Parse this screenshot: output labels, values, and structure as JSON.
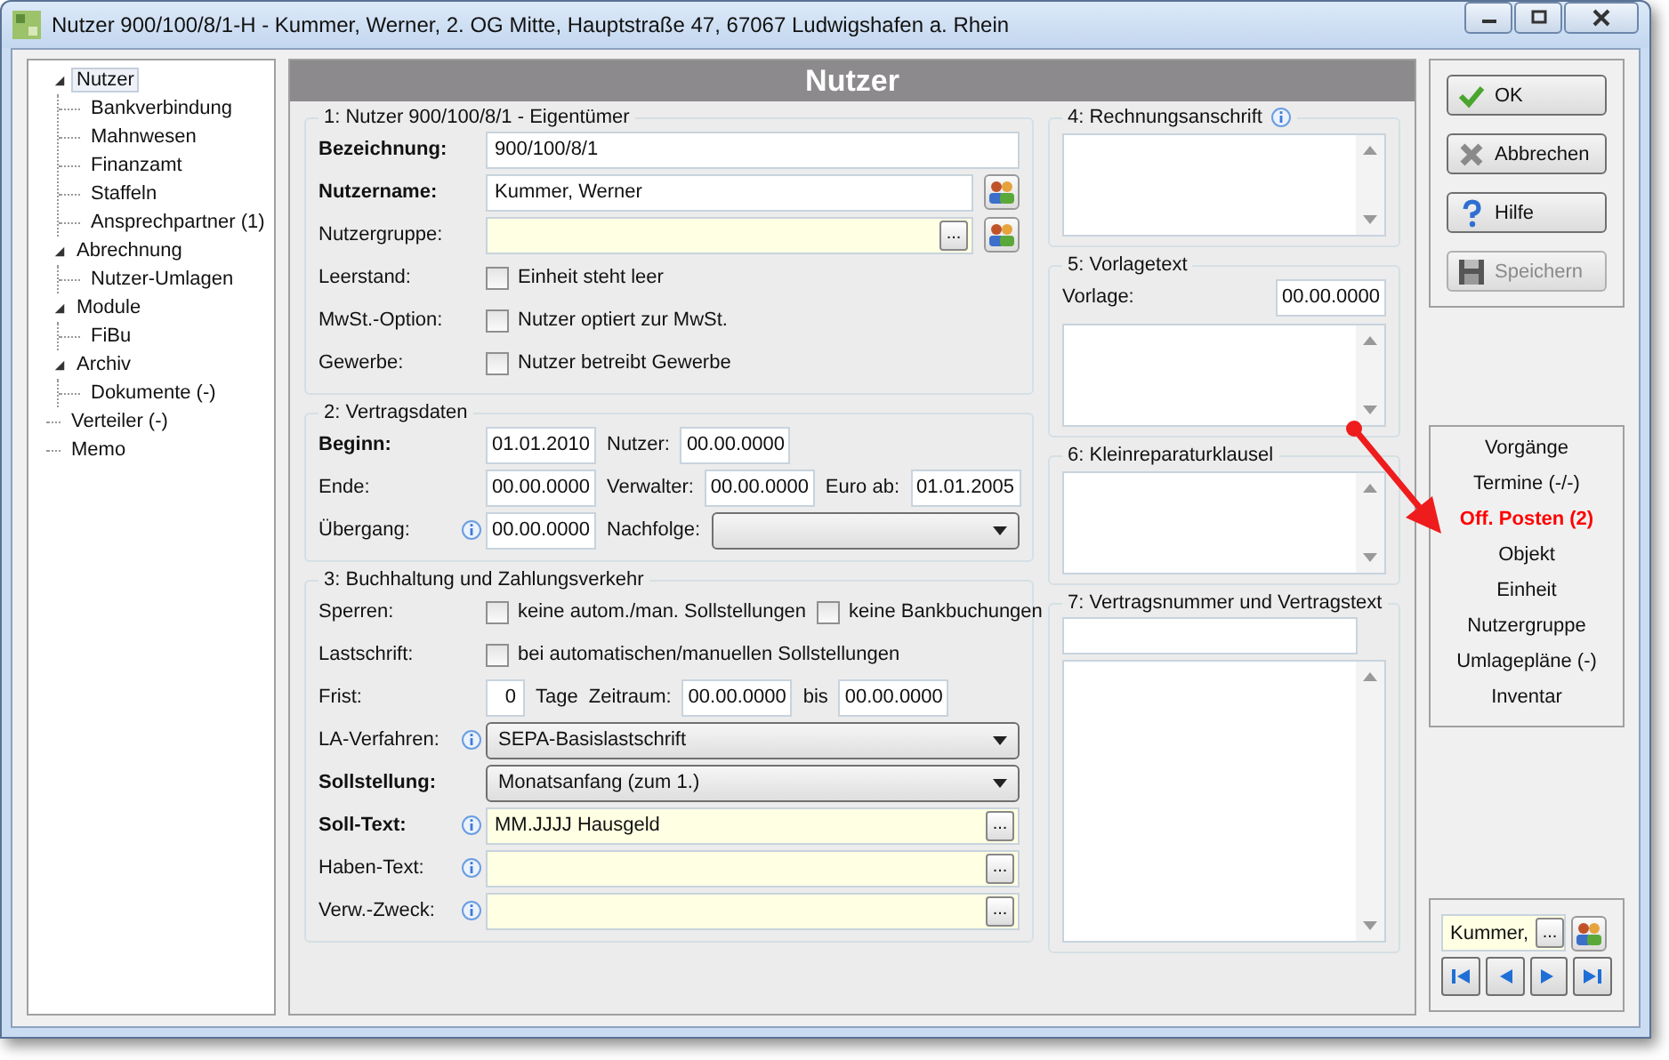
{
  "window": {
    "title": "Nutzer 900/100/8/1-H - Kummer, Werner, 2. OG Mitte, Hauptstraße 47, 67067 Ludwigshafen a. Rhein",
    "controls": [
      {
        "kind": "minimize"
      },
      {
        "kind": "maximize"
      },
      {
        "kind": "close"
      }
    ]
  },
  "tree": [
    {
      "label": "Nutzer",
      "selected": true,
      "expanded": true,
      "children": [
        {
          "label": "Bankverbindung",
          "selected": false
        },
        {
          "label": "Mahnwesen",
          "selected": false
        },
        {
          "label": "Finanzamt",
          "selected": false
        },
        {
          "label": "Staffeln",
          "selected": false
        },
        {
          "label": "Ansprechpartner (1)",
          "selected": false
        }
      ]
    },
    {
      "label": "Abrechnung",
      "selected": false,
      "expanded": true,
      "children": [
        {
          "label": "Nutzer-Umlagen",
          "selected": false
        }
      ]
    },
    {
      "label": "Module",
      "selected": false,
      "expanded": true,
      "children": [
        {
          "label": "FiBu",
          "selected": false
        }
      ]
    },
    {
      "label": "Archiv",
      "selected": false,
      "expanded": true,
      "children": [
        {
          "label": "Dokumente (-)",
          "selected": false
        }
      ]
    },
    {
      "label": "Verteiler (-)",
      "selected": false
    },
    {
      "label": "Memo",
      "selected": false
    }
  ],
  "header": "Nutzer",
  "left_sections": [
    {
      "title": "1: Nutzer 900/100/8/1 - Eigentümer",
      "rows": [
        {
          "label": "Bezeichnung:",
          "bold": true,
          "info": false,
          "controls": [
            {
              "kind": "text",
              "value": "900/100/8/1"
            }
          ]
        },
        {
          "label": "Nutzername:",
          "bold": true,
          "info": false,
          "controls": [
            {
              "kind": "text",
              "value": "Kummer, Werner"
            },
            {
              "kind": "people"
            }
          ]
        },
        {
          "label": "Nutzergruppe:",
          "bold": false,
          "info": false,
          "controls": [
            {
              "kind": "lookup",
              "dots": "..."
            },
            {
              "kind": "people"
            }
          ]
        },
        {
          "label": "Leerstand:",
          "bold": false,
          "info": false,
          "controls": [
            {
              "kind": "check",
              "label": "Einheit steht leer",
              "checked": false
            }
          ]
        },
        {
          "label": "MwSt.-Option:",
          "bold": false,
          "info": false,
          "controls": [
            {
              "kind": "check",
              "label": "Nutzer optiert zur MwSt.",
              "checked": false
            }
          ]
        },
        {
          "label": "Gewerbe:",
          "bold": false,
          "info": false,
          "controls": [
            {
              "kind": "check",
              "label": "Nutzer betreibt Gewerbe",
              "checked": false
            }
          ]
        }
      ]
    },
    {
      "title": "2: Vertragsdaten",
      "rows": [
        {
          "label": "Beginn:",
          "bold": true,
          "info": false,
          "controls": [
            {
              "kind": "date",
              "value": "01.01.2010"
            },
            {
              "kind": "word",
              "text": "Nutzer:"
            },
            {
              "kind": "date",
              "value": "00.00.0000"
            }
          ]
        },
        {
          "label": "Ende:",
          "bold": false,
          "info": false,
          "controls": [
            {
              "kind": "date",
              "value": "00.00.0000"
            },
            {
              "kind": "word",
              "text": "Verwalter:"
            },
            {
              "kind": "date",
              "value": "00.00.0000"
            },
            {
              "kind": "word",
              "text": "Euro ab:"
            },
            {
              "kind": "date",
              "value": "01.01.2005"
            }
          ]
        },
        {
          "label": "Übergang:",
          "bold": false,
          "info": true,
          "controls": [
            {
              "kind": "date",
              "value": "00.00.0000"
            },
            {
              "kind": "word",
              "text": "Nachfolge:"
            },
            {
              "kind": "select"
            }
          ]
        }
      ]
    },
    {
      "title": "3: Buchhaltung und Zahlungsverkehr",
      "rows": [
        {
          "label": "Sperren:",
          "bold": false,
          "info": false,
          "controls": [
            {
              "kind": "check",
              "label": "keine autom./man. Sollstellungen",
              "checked": false
            },
            {
              "kind": "check",
              "label": "keine Bankbuchungen",
              "checked": false
            }
          ]
        },
        {
          "label": "Lastschrift:",
          "bold": false,
          "info": false,
          "controls": [
            {
              "kind": "check",
              "label": "bei automatischen/manuellen Sollstellungen",
              "checked": false
            }
          ]
        },
        {
          "label": "Frist:",
          "bold": false,
          "info": false,
          "controls": [
            {
              "kind": "num",
              "value": "0"
            },
            {
              "kind": "word",
              "text": "Tage"
            },
            {
              "kind": "word",
              "text": "Zeitraum:"
            },
            {
              "kind": "date",
              "value": "00.00.0000"
            },
            {
              "kind": "word",
              "text": "bis"
            },
            {
              "kind": "date",
              "value": "00.00.0000"
            }
          ]
        },
        {
          "label": "LA-Verfahren:",
          "bold": false,
          "info": true,
          "controls": [
            {
              "kind": "select",
              "value": "SEPA-Basislastschrift"
            }
          ]
        },
        {
          "label": "Sollstellung:",
          "bold": true,
          "info": false,
          "controls": [
            {
              "kind": "select",
              "value": "Monatsanfang (zum 1.)"
            }
          ]
        },
        {
          "label": "Soll-Text:",
          "bold": true,
          "info": true,
          "controls": [
            {
              "kind": "lookup",
              "value": "MM.JJJJ Hausgeld",
              "dots": "..."
            }
          ]
        },
        {
          "label": "Haben-Text:",
          "bold": false,
          "info": true,
          "controls": [
            {
              "kind": "lookup",
              "dots": "..."
            }
          ]
        },
        {
          "label": "Verw.-Zweck:",
          "bold": false,
          "info": true,
          "controls": [
            {
              "kind": "lookup",
              "dots": "..."
            }
          ]
        }
      ]
    }
  ],
  "right_sections": [
    {
      "title": "4: Rechnungsanschrift",
      "info": true
    },
    {
      "title": "5: Vorlagetext",
      "info": false,
      "field_label": "Vorlage:",
      "field_value": "00.00.0000"
    },
    {
      "title": "6: Kleinreparaturklausel",
      "info": false
    },
    {
      "title": "7: Vertragsnummer und Vertragstext",
      "info": false,
      "input": true
    }
  ],
  "buttons": [
    {
      "kind": "ok",
      "label": "OK",
      "disabled": false
    },
    {
      "kind": "cancel",
      "label": "Abbrechen",
      "disabled": false
    },
    {
      "kind": "help",
      "label": "Hilfe",
      "disabled": false
    },
    {
      "kind": "save",
      "label": "Speichern",
      "disabled": true
    }
  ],
  "links": [
    {
      "label": "Vorgänge",
      "highlighted": false
    },
    {
      "label": "Termine (-/-)",
      "highlighted": false
    },
    {
      "label": "Off. Posten (2)",
      "highlighted": true
    },
    {
      "label": "Objekt",
      "highlighted": false
    },
    {
      "label": "Einheit",
      "highlighted": false
    },
    {
      "label": "Nutzergruppe",
      "highlighted": false
    },
    {
      "label": "Umlagepläne (-)",
      "highlighted": false
    },
    {
      "label": "Inventar",
      "highlighted": false
    }
  ],
  "search": {
    "value": "Kummer,",
    "dots": "..."
  },
  "nav_buttons": [
    {
      "kind": "first"
    },
    {
      "kind": "prev"
    },
    {
      "kind": "next"
    },
    {
      "kind": "last"
    }
  ]
}
